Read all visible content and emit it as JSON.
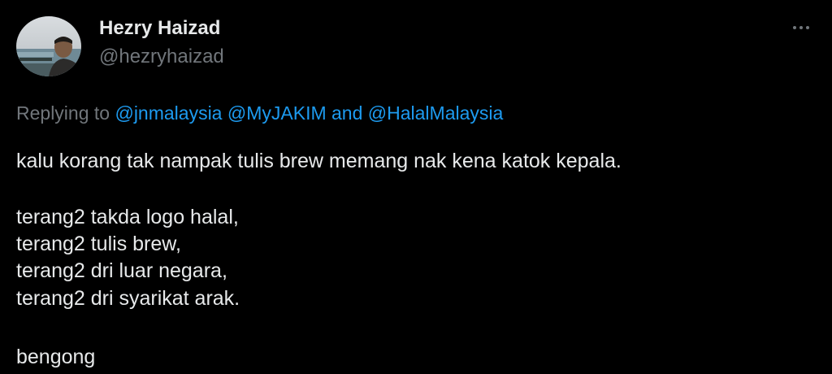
{
  "tweet": {
    "author": {
      "display_name": "Hezry Haizad",
      "handle": "@hezryhaizad",
      "avatar_icon": "profile-photo"
    },
    "more_icon": "more-horizontal-icon",
    "replying": {
      "prefix": "Replying to",
      "mention_1": "@jnmalaysia",
      "mention_2": "@MyJAKIM",
      "conjunction": "and",
      "mention_3": "@HalalMalaysia"
    },
    "lines": {
      "line_1": "kalu korang tak nampak tulis brew memang nak kena katok kepala.",
      "line_2": "terang2 takda logo halal,",
      "line_3": "terang2 tulis brew,",
      "line_4": "terang2 dri luar negara,",
      "line_5": "terang2 dri syarikat arak.",
      "line_6": "bengong"
    },
    "colors": {
      "background": "#000000",
      "text": "#e7e9ea",
      "secondary": "#71767b",
      "link": "#1d9bf0"
    }
  }
}
